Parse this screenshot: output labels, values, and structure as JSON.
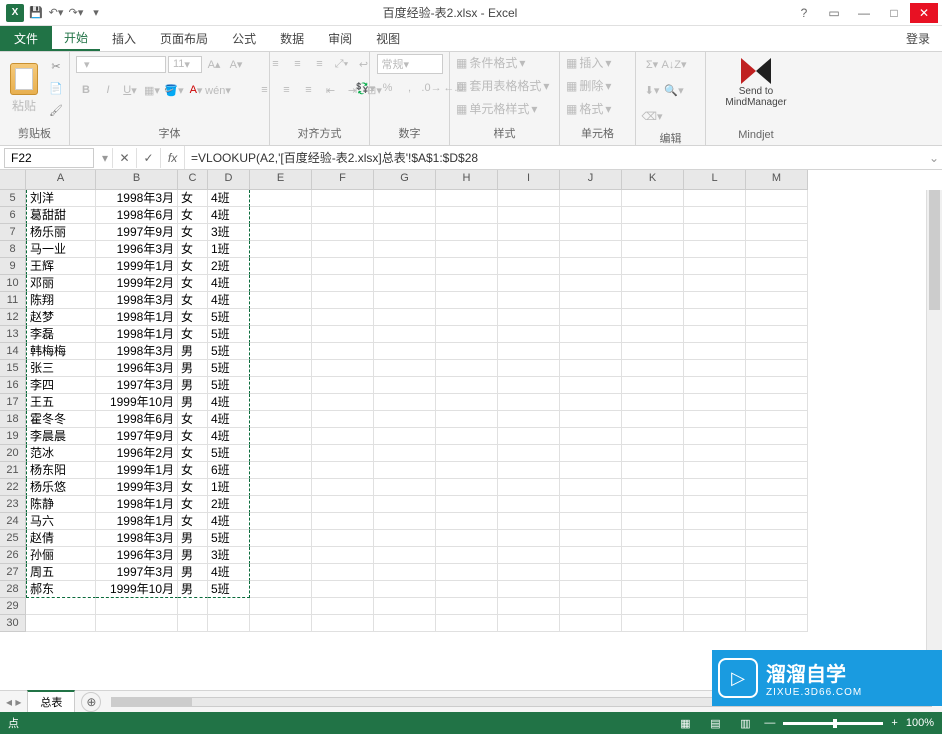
{
  "titlebar": {
    "title": "百度经验-表2.xlsx - Excel",
    "help": "?",
    "ribbonOpts": "▭",
    "minimize": "—",
    "maximize": "□",
    "close": "✕"
  },
  "qat": {
    "save": "💾",
    "undo": "↶",
    "redo": "↷",
    "customize": "▾"
  },
  "tabs": {
    "file": "文件",
    "home": "开始",
    "insert": "插入",
    "pageLayout": "页面布局",
    "formulas": "公式",
    "data": "数据",
    "review": "审阅",
    "view": "视图",
    "login": "登录"
  },
  "ribbon": {
    "clipboard": {
      "label": "剪贴板",
      "paste": "粘贴"
    },
    "font": {
      "label": "字体",
      "size": "11"
    },
    "alignment": {
      "label": "对齐方式"
    },
    "number": {
      "label": "数字",
      "format": "常规"
    },
    "styles": {
      "label": "样式",
      "conditional": "条件格式",
      "table": "套用表格格式",
      "cell": "单元格样式"
    },
    "cells": {
      "label": "单元格",
      "insert": "插入",
      "delete": "删除",
      "format": "格式"
    },
    "editing": {
      "label": "编辑"
    },
    "mindjet": {
      "label": "Mindjet",
      "send": "Send to MindManager"
    }
  },
  "formulaBar": {
    "nameBox": "F22",
    "formula": "=VLOOKUP(A2,'[百度经验-表2.xlsx]总表'!$A$1:$D$28"
  },
  "columns": [
    "A",
    "B",
    "C",
    "D",
    "E",
    "F",
    "G",
    "H",
    "I",
    "J",
    "K",
    "L",
    "M"
  ],
  "rows": [
    {
      "n": 5,
      "a": "刘洋",
      "b": "1998年3月",
      "c": "女",
      "d": "4班"
    },
    {
      "n": 6,
      "a": "葛甜甜",
      "b": "1998年6月",
      "c": "女",
      "d": "4班"
    },
    {
      "n": 7,
      "a": "杨乐丽",
      "b": "1997年9月",
      "c": "女",
      "d": "3班"
    },
    {
      "n": 8,
      "a": "马一业",
      "b": "1996年3月",
      "c": "女",
      "d": "1班"
    },
    {
      "n": 9,
      "a": "王辉",
      "b": "1999年1月",
      "c": "女",
      "d": "2班"
    },
    {
      "n": 10,
      "a": "邓丽",
      "b": "1999年2月",
      "c": "女",
      "d": "4班"
    },
    {
      "n": 11,
      "a": "陈翔",
      "b": "1998年3月",
      "c": "女",
      "d": "4班"
    },
    {
      "n": 12,
      "a": "赵梦",
      "b": "1998年1月",
      "c": "女",
      "d": "5班"
    },
    {
      "n": 13,
      "a": "李磊",
      "b": "1998年1月",
      "c": "女",
      "d": "5班"
    },
    {
      "n": 14,
      "a": "韩梅梅",
      "b": "1998年3月",
      "c": "男",
      "d": "5班"
    },
    {
      "n": 15,
      "a": "张三",
      "b": "1996年3月",
      "c": "男",
      "d": "5班"
    },
    {
      "n": 16,
      "a": "李四",
      "b": "1997年3月",
      "c": "男",
      "d": "5班"
    },
    {
      "n": 17,
      "a": "王五",
      "b": "1999年10月",
      "c": "男",
      "d": "4班"
    },
    {
      "n": 18,
      "a": "霍冬冬",
      "b": "1998年6月",
      "c": "女",
      "d": "4班"
    },
    {
      "n": 19,
      "a": "李晨晨",
      "b": "1997年9月",
      "c": "女",
      "d": "4班"
    },
    {
      "n": 20,
      "a": "范冰",
      "b": "1996年2月",
      "c": "女",
      "d": "5班"
    },
    {
      "n": 21,
      "a": "杨东阳",
      "b": "1999年1月",
      "c": "女",
      "d": "6班"
    },
    {
      "n": 22,
      "a": "杨乐悠",
      "b": "1999年3月",
      "c": "女",
      "d": "1班"
    },
    {
      "n": 23,
      "a": "陈静",
      "b": "1998年1月",
      "c": "女",
      "d": "2班"
    },
    {
      "n": 24,
      "a": "马六",
      "b": "1998年1月",
      "c": "女",
      "d": "4班"
    },
    {
      "n": 25,
      "a": "赵倩",
      "b": "1998年3月",
      "c": "男",
      "d": "5班"
    },
    {
      "n": 26,
      "a": "孙俪",
      "b": "1996年3月",
      "c": "男",
      "d": "3班"
    },
    {
      "n": 27,
      "a": "周五",
      "b": "1997年3月",
      "c": "男",
      "d": "4班"
    },
    {
      "n": 28,
      "a": "郝东",
      "b": "1999年10月",
      "c": "男",
      "d": "5班"
    },
    {
      "n": 29,
      "a": "",
      "b": "",
      "c": "",
      "d": ""
    },
    {
      "n": 30,
      "a": "",
      "b": "",
      "c": "",
      "d": ""
    }
  ],
  "sheetTabs": {
    "sheet1": "总表",
    "add": "⊕"
  },
  "statusbar": {
    "mode": "点",
    "zoom": "100%",
    "plus": "+",
    "minus": "—"
  },
  "watermark": {
    "brand": "溜溜自学",
    "url": "ZIXUE.3D66.COM",
    "play": "▷"
  }
}
